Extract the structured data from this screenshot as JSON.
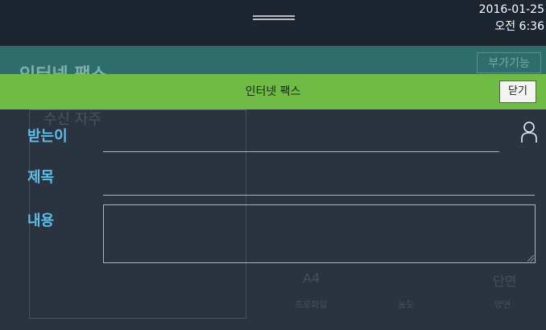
{
  "status_bar": {
    "date": "2016-01-25",
    "time": "오전 6:36"
  },
  "background_app": {
    "title": "인터넷 팩스",
    "extra_button": "부가기능",
    "address_label": "수신 자주",
    "paper_size": "A4",
    "paper_size_sub": "프로파일",
    "density_sub": "농도",
    "sides": "단면",
    "sides_sub": "양면"
  },
  "modal": {
    "title": "인터넷 팩스",
    "close_label": "닫기",
    "fields": {
      "recipient": {
        "label": "받는이",
        "value": ""
      },
      "subject": {
        "label": "제목",
        "value": ""
      },
      "content": {
        "label": "내용",
        "value": ""
      }
    }
  },
  "colors": {
    "header_green": "#6fbb45",
    "label_blue": "#5cc0ea",
    "background": "#2a3440"
  },
  "icons": {
    "contacts": "person-outline-icon"
  }
}
